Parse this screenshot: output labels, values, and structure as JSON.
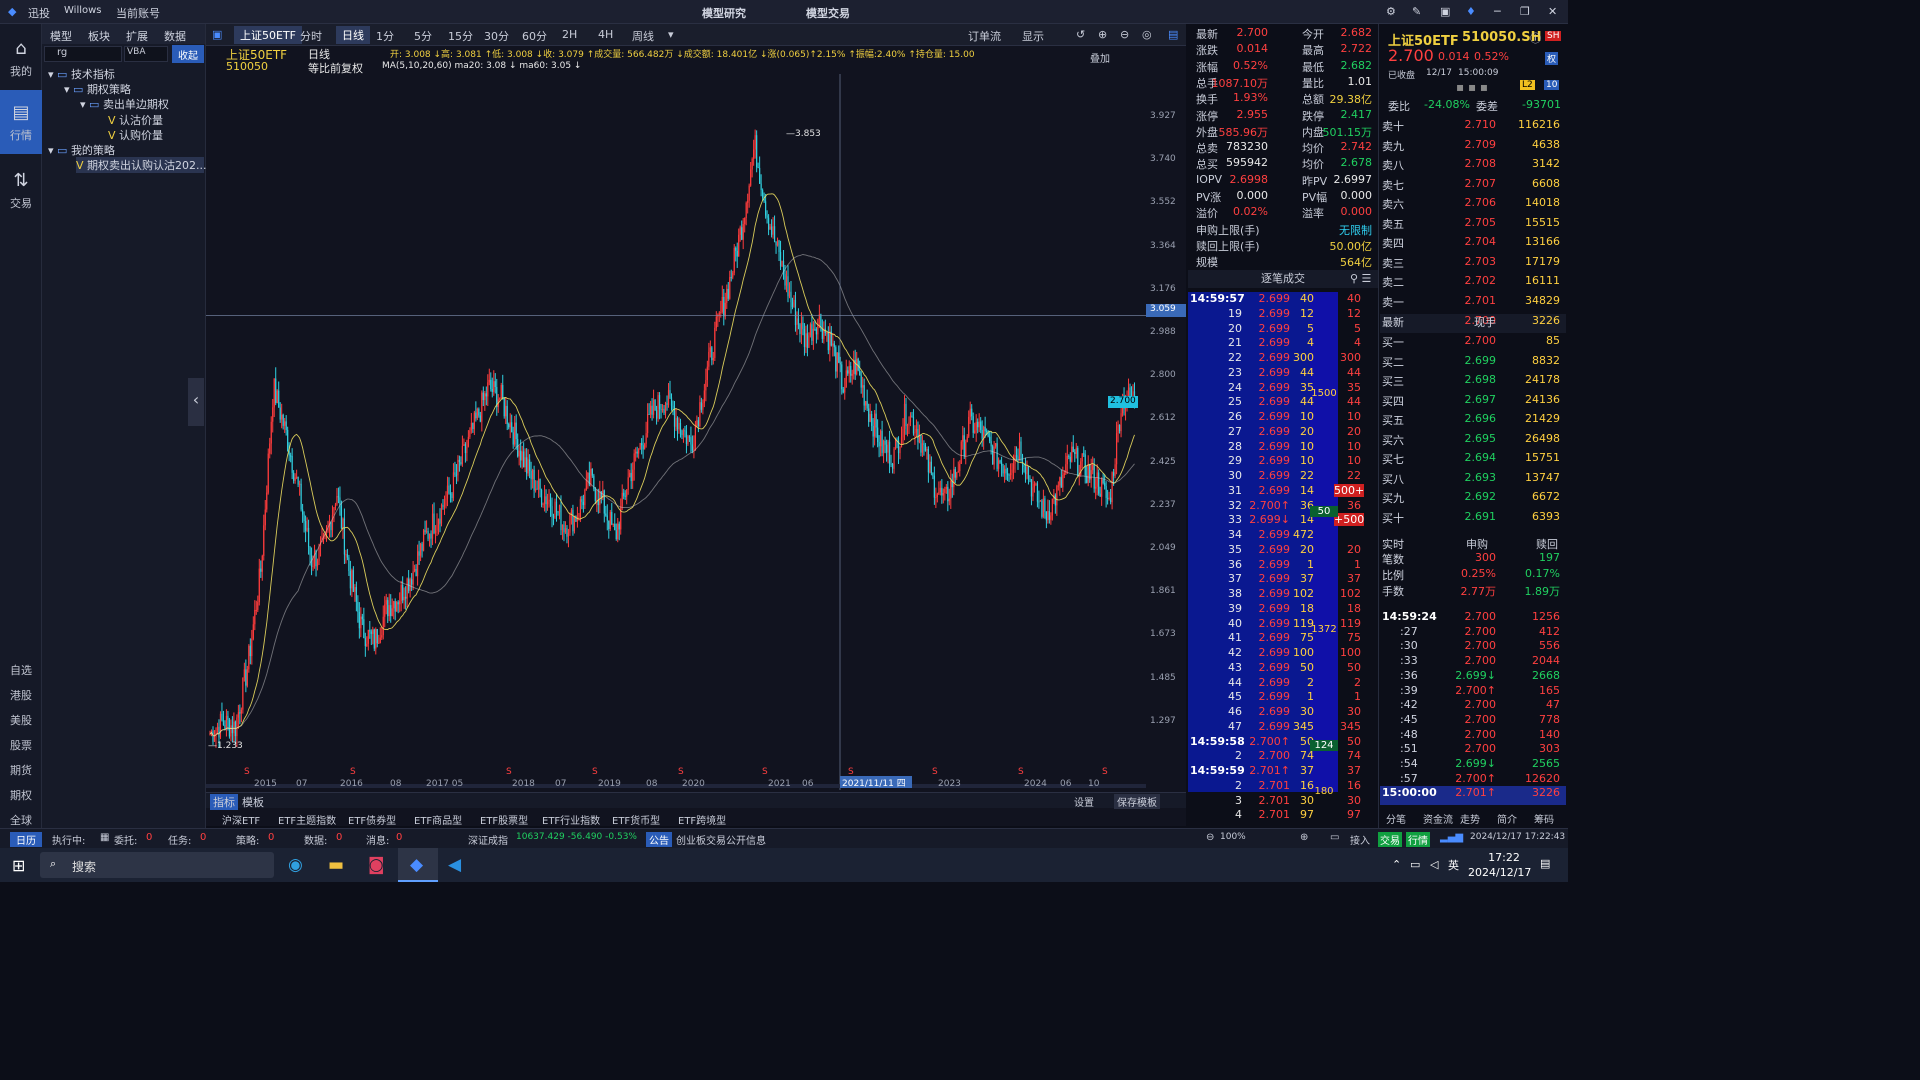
{
  "titlebar": {
    "brand": "迅投",
    "user": "Willows",
    "account": "当前账号",
    "tab1": "模型研究",
    "tab2": "模型交易"
  },
  "leftrail": {
    "items": [
      {
        "label": "我的",
        "icon": "home-icon"
      },
      {
        "label": "行情",
        "icon": "chart-icon"
      },
      {
        "label": "交易",
        "icon": "trade-icon"
      }
    ],
    "bottom": [
      "自选",
      "港股",
      "美股",
      "股票",
      "期货",
      "期权",
      "全球"
    ]
  },
  "tree": {
    "tabs": [
      "模型",
      "板块",
      "扩展",
      "数据"
    ],
    "search_value": "rg",
    "type_value": "VBA",
    "collapse": "收起",
    "rows": [
      "技术指标",
      "期权策略",
      "卖出单边期权",
      "认沽价量",
      "认购价量",
      "我的策略",
      "期权卖出认购认沽202..."
    ]
  },
  "toolbar": {
    "symbol": "上证50ETF",
    "periods": [
      "分时",
      "日线",
      "1分",
      "5分",
      "15分",
      "30分",
      "60分",
      "2H",
      "4H",
      "周线"
    ],
    "selected": "日线",
    "orderflow": "订单流",
    "display": "显示"
  },
  "infobar": {
    "name": "上证50ETF",
    "code": "510050",
    "period": "日线",
    "adjust": "等比前复权",
    "ohlc": "开: 3.008 ↓高: 3.081 ↑低: 3.008 ↓收: 3.079 ↑成交量: 566.482万 ↓成交额: 18.401亿 ↓涨(0.065)↑2.15% ↑振幅:2.40% ↑持仓量: 15.00",
    "ma": "MA(5,10,20,60)  ma20: 3.08 ↓ ma60: 3.05 ↓",
    "overlay": "叠加"
  },
  "chart_data": {
    "type": "candlestick",
    "symbol": "上证50ETF",
    "max_label": "3.853",
    "min_label": "1.233",
    "last_label": "2.700",
    "crosshair_label": "3.059",
    "cursor_date": "2021/11/11 四",
    "yticks": [
      "3.927",
      "3.740",
      "3.552",
      "3.364",
      "3.176",
      "2.988",
      "2.800",
      "2.612",
      "2.425",
      "2.237",
      "2.049",
      "1.861",
      "1.673",
      "1.485",
      "1.297"
    ],
    "xticks": [
      "2015",
      "07",
      "2016",
      "08",
      "2017 05",
      "2018",
      "07",
      "2019",
      "08",
      "2020",
      "2021",
      "06",
      "2023",
      "2024",
      "06",
      "10"
    ],
    "close_series": [
      1.25,
      1.3,
      1.28,
      1.55,
      1.95,
      2.75,
      2.55,
      2.3,
      2.0,
      2.05,
      2.3,
      1.95,
      1.7,
      1.65,
      1.8,
      1.85,
      1.95,
      2.1,
      2.2,
      2.3,
      2.45,
      2.6,
      2.75,
      2.7,
      2.55,
      2.4,
      2.3,
      2.25,
      2.15,
      2.2,
      2.35,
      2.25,
      2.1,
      2.35,
      2.5,
      2.65,
      2.7,
      2.6,
      2.5,
      2.75,
      3.0,
      3.2,
      3.45,
      3.8,
      3.5,
      3.3,
      3.1,
      2.95,
      3.05,
      2.95,
      2.75,
      2.85,
      2.65,
      2.5,
      2.45,
      2.65,
      2.55,
      2.35,
      2.25,
      2.4,
      2.6,
      2.55,
      2.45,
      2.4,
      2.5,
      2.3,
      2.2,
      2.3,
      2.45,
      2.4,
      2.35,
      2.25,
      2.7,
      2.7
    ]
  },
  "bottom": {
    "tab1": "指标",
    "tab2": "模板",
    "settings": "设置",
    "save": "保存模板"
  },
  "etftabs": [
    "沪深ETF",
    "ETF主题指数",
    "ETF债券型",
    "ETF商品型",
    "ETF股票型",
    "ETF行业指数",
    "ETF货币型",
    "ETF跨境型"
  ],
  "quote": [
    [
      "最新",
      "2.700",
      "今开",
      "2.682"
    ],
    [
      "涨跌",
      "0.014",
      "最高",
      "2.722"
    ],
    [
      "涨幅",
      "0.52%",
      "最低",
      "2.682"
    ],
    [
      "总手",
      "1087.10万",
      "量比",
      "1.01"
    ],
    [
      "换手",
      "1.93%",
      "总额",
      "29.38亿"
    ],
    [
      "涨停",
      "2.955",
      "跌停",
      "2.417"
    ],
    [
      "外盘",
      "585.96万",
      "内盘",
      "501.15万"
    ],
    [
      "总卖",
      "783230",
      "均价",
      "2.742"
    ],
    [
      "总买",
      "595942",
      "均价",
      "2.678"
    ],
    [
      "IOPV",
      "2.6998",
      "昨PV",
      "2.6997"
    ],
    [
      "PV涨",
      "0.000",
      "PV幅",
      "0.000"
    ],
    [
      "溢价",
      "0.02%",
      "溢率",
      "0.000"
    ],
    [
      "申购上限(手)",
      "",
      "",
      "无限制"
    ],
    [
      "赎回上限(手)",
      "",
      "",
      "50.00亿"
    ],
    [
      "规模",
      "",
      "",
      "564亿"
    ]
  ],
  "ticks_header": "逐笔成交",
  "ticks": [
    [
      "14:59:57",
      "2.699",
      "40",
      "40"
    ],
    [
      "19",
      "2.699",
      "12",
      "12"
    ],
    [
      "20",
      "2.699",
      "5",
      "5"
    ],
    [
      "21",
      "2.699",
      "4",
      "4"
    ],
    [
      "22",
      "2.699",
      "300",
      "300"
    ],
    [
      "23",
      "2.699",
      "44",
      "44"
    ],
    [
      "24",
      "2.699",
      "35",
      "35"
    ],
    [
      "25",
      "2.699",
      "44",
      "44"
    ],
    [
      "26",
      "2.699",
      "10",
      "10"
    ],
    [
      "27",
      "2.699",
      "20",
      "20"
    ],
    [
      "28",
      "2.699",
      "10",
      "10"
    ],
    [
      "29",
      "2.699",
      "10",
      "10"
    ],
    [
      "30",
      "2.699",
      "22",
      "22"
    ],
    [
      "31",
      "2.699",
      "14",
      "500+"
    ],
    [
      "32",
      "2.700↑",
      "36",
      "36"
    ],
    [
      "33",
      "2.699↓",
      "14",
      "+500"
    ],
    [
      "34",
      "2.699",
      "472",
      ""
    ],
    [
      "35",
      "2.699",
      "20",
      "20"
    ],
    [
      "36",
      "2.699",
      "1",
      "1"
    ],
    [
      "37",
      "2.699",
      "37",
      "37"
    ],
    [
      "38",
      "2.699",
      "102",
      "102"
    ],
    [
      "39",
      "2.699",
      "18",
      "18"
    ],
    [
      "40",
      "2.699",
      "119",
      "119"
    ],
    [
      "41",
      "2.699",
      "75",
      "75"
    ],
    [
      "42",
      "2.699",
      "100",
      "100"
    ],
    [
      "43",
      "2.699",
      "50",
      "50"
    ],
    [
      "44",
      "2.699",
      "2",
      "2"
    ],
    [
      "45",
      "2.699",
      "1",
      "1"
    ],
    [
      "46",
      "2.699",
      "30",
      "30"
    ],
    [
      "47",
      "2.699",
      "345",
      "345"
    ],
    [
      "14:59:58",
      "2.700↑",
      "50",
      "50"
    ],
    [
      "2",
      "2.700",
      "74",
      "74"
    ],
    [
      "14:59:59",
      "2.701↑",
      "37",
      "37"
    ],
    [
      "2",
      "2.701",
      "16",
      "16"
    ],
    [
      "3",
      "2.701",
      "30",
      "30"
    ],
    [
      "4",
      "2.701",
      "97",
      "97"
    ]
  ],
  "tick_groups": [
    "1500",
    "50",
    "1372",
    "124",
    "180"
  ],
  "depth_head": {
    "name": "上证50ETF",
    "code": "510050.SH",
    "market": "SH",
    "price": "2.700",
    "change": "0.014",
    "pct": "0.52%",
    "status": "已收盘",
    "date": "12/17",
    "time": "15:00:09",
    "weibi_label": "委比",
    "weibi": "-24.08%",
    "weicha_label": "委差",
    "weicha": "-93701"
  },
  "asks": [
    [
      "卖十",
      "2.710",
      "116216"
    ],
    [
      "卖九",
      "2.709",
      "4638"
    ],
    [
      "卖八",
      "2.708",
      "3142"
    ],
    [
      "卖七",
      "2.707",
      "6608"
    ],
    [
      "卖六",
      "2.706",
      "14018"
    ],
    [
      "卖五",
      "2.705",
      "15515"
    ],
    [
      "卖四",
      "2.704",
      "13166"
    ],
    [
      "卖三",
      "2.703",
      "17179"
    ],
    [
      "卖二",
      "2.702",
      "16111"
    ],
    [
      "卖一",
      "2.701",
      "34829"
    ]
  ],
  "last_row": [
    "最新",
    "2.700",
    "现手",
    "3226"
  ],
  "bids": [
    [
      "买一",
      "2.700",
      "85"
    ],
    [
      "买二",
      "2.699",
      "8832"
    ],
    [
      "买三",
      "2.698",
      "24178"
    ],
    [
      "买四",
      "2.697",
      "24136"
    ],
    [
      "买五",
      "2.696",
      "21429"
    ],
    [
      "买六",
      "2.695",
      "26498"
    ],
    [
      "买七",
      "2.694",
      "15751"
    ],
    [
      "买八",
      "2.693",
      "13747"
    ],
    [
      "买九",
      "2.692",
      "6672"
    ],
    [
      "买十",
      "2.691",
      "6393"
    ]
  ],
  "creation": {
    "hdr": [
      "实时",
      "申购",
      "赎回"
    ],
    "rows": [
      [
        "笔数",
        "300",
        "197"
      ],
      [
        "比例",
        "0.25%",
        "0.17%"
      ],
      [
        "手数",
        "2.77万",
        "1.89万"
      ]
    ]
  },
  "minute_ticks": [
    [
      "14:59:24",
      "2.700",
      "1256"
    ],
    [
      ":27",
      "2.700",
      "412"
    ],
    [
      ":30",
      "2.700",
      "556"
    ],
    [
      ":33",
      "2.700",
      "2044"
    ],
    [
      ":36",
      "2.699↓",
      "2668"
    ],
    [
      ":39",
      "2.700↑",
      "165"
    ],
    [
      ":42",
      "2.700",
      "47"
    ],
    [
      ":45",
      "2.700",
      "778"
    ],
    [
      ":48",
      "2.700",
      "140"
    ],
    [
      ":51",
      "2.700",
      "303"
    ],
    [
      ":54",
      "2.699↓",
      "2565"
    ],
    [
      ":57",
      "2.700↑",
      "12620"
    ],
    [
      "15:00:00",
      "2.701↑",
      "3226"
    ]
  ],
  "depth_tabs": [
    "分笔",
    "资金流",
    "走势",
    "简介",
    "筹码"
  ],
  "status": {
    "date_btn": "日历",
    "exec": "执行中:",
    "entrust": "委托:",
    "entrust_n": "0",
    "task": "任务:",
    "task_n": "0",
    "strategy": "策略:",
    "strategy_n": "0",
    "data": "数据:",
    "data_n": "0",
    "msg": "消息:",
    "msg_n": "0",
    "index": "深证成指",
    "index_v": "10637.429  -56.490  -0.53%",
    "notice": "公告",
    "notice_text": "创业板交易公开信息",
    "zoom": "100%",
    "connect": "接入",
    "trade": "交易",
    "quote": "行情",
    "datetime": "2024/12/17  17:22:43"
  },
  "taskbar": {
    "search": "搜索",
    "time": "17:22",
    "date": "2024/12/17",
    "lang": "英"
  }
}
